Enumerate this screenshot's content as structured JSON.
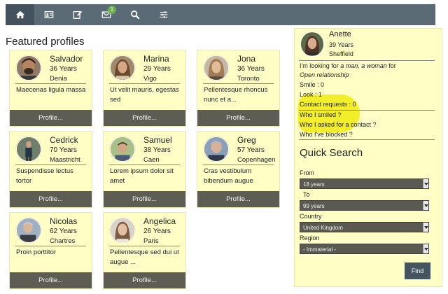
{
  "nav": {
    "items": [
      {
        "icon": "home-icon",
        "active": true
      },
      {
        "icon": "profile-card-icon",
        "active": false
      },
      {
        "icon": "edit-icon",
        "active": false
      },
      {
        "icon": "mail-icon",
        "active": false,
        "badge": "1"
      },
      {
        "icon": "search-icon",
        "active": false
      },
      {
        "icon": "sliders-icon",
        "active": false
      }
    ]
  },
  "featured": {
    "title": "Featured profiles",
    "profiles": [
      {
        "name": "Salvador",
        "age": "36 Years",
        "city": "Denia",
        "desc": "Maecenas ligula massa",
        "button": "Profile..."
      },
      {
        "name": "Marina",
        "age": "29 Years",
        "city": "Vigo",
        "desc": "Ut velit mauris, egestas sed",
        "button": "Profile..."
      },
      {
        "name": "Jona",
        "age": "36 Years",
        "city": "Toronto",
        "desc": "Pellentesque rhoncus nunc et a...",
        "button": "Profile..."
      },
      {
        "name": "Cedrick",
        "age": "70 Years",
        "city": "Maastricht",
        "desc": "Suspendisse lectus tortor",
        "button": "Profile..."
      },
      {
        "name": "Samuel",
        "age": "38 Years",
        "city": "Caen",
        "desc": "Lorem ipsum dolor sit amet",
        "button": "Profile..."
      },
      {
        "name": "Greg",
        "age": "57 Years",
        "city": "Copenhagen",
        "desc": "Cras vestibulum bibendum augue",
        "button": "Profile..."
      },
      {
        "name": "Nicolas",
        "age": "62 Years",
        "city": "Chartres",
        "desc": "Proin porttitor",
        "button": "Profile..."
      },
      {
        "name": "Angelica",
        "age": "26 Years",
        "city": "Paris",
        "desc": "Pellentesque sed dui ut augue ...",
        "button": "Profile..."
      }
    ]
  },
  "me": {
    "name": "Anette",
    "age": "39 Years",
    "city": "Sheffield",
    "looking_prefix": "I'm looking for ",
    "looking_em": "a man, a woman",
    "looking_mid": "  for ",
    "looking_em2": "Open relationship",
    "smile": "Smile : 0",
    "look": "Look : 1",
    "contact_requests": "Contact requests : 0",
    "links": [
      "Who I smiled ?",
      "Who I asked for a contact ?",
      "Who I've blocked ?"
    ]
  },
  "quick_search": {
    "title": "Quick Search",
    "from_label": "From",
    "from_value": "18 years",
    "to_label": "To",
    "to_value": "99 years",
    "country_label": "Country",
    "country_value": "United Kingdom",
    "region_label": "Region",
    "region_value": "- Immaterial -",
    "find_label": "Find"
  },
  "colors": {
    "nav_bg": "#5b6b76",
    "card_bg": "#ffffc5",
    "button_bg": "#5d5d54",
    "highlight": "#f2ef2a",
    "badge": "#6ab04c"
  }
}
